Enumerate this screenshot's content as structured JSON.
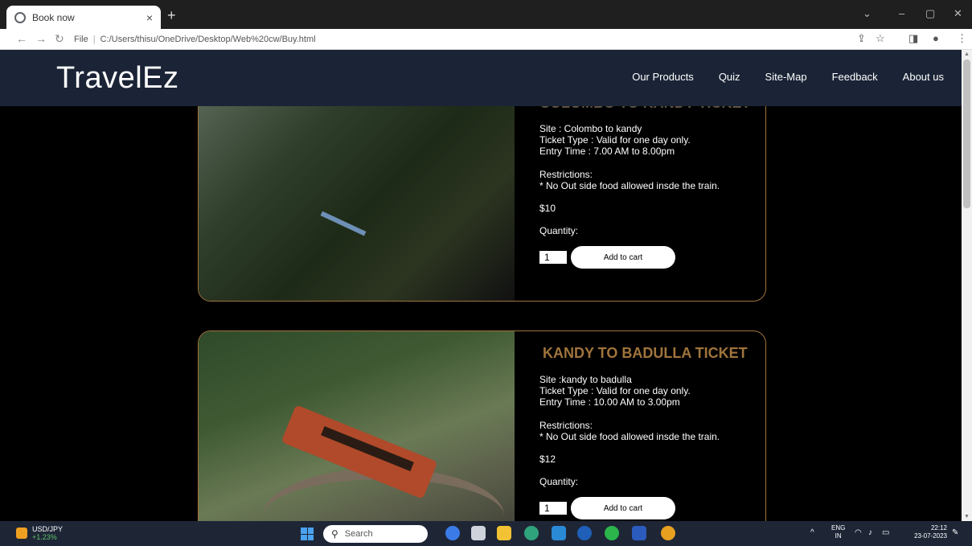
{
  "browser": {
    "tab_title": "Book now",
    "tab_close": "×",
    "new_tab": "+",
    "url_info_icon": "ⓘ",
    "url_scheme": "File",
    "url_path": "C:/Users/thisu/OneDrive/Desktop/Web%20cw/Buy.html"
  },
  "site": {
    "logo": "TravelEz",
    "nav": [
      "Our Products",
      "Quiz",
      "Site-Map",
      "Feedback",
      "About us"
    ]
  },
  "tickets": [
    {
      "title": "COLOMBO TO KANDY TICKET",
      "site": "Site : Colombo to kandy",
      "type": "Ticket Type : Valid for one day only.",
      "entry": "Entry Time : 7.00 AM to 8.00pm",
      "restrictions_label": "Restrictions:",
      "restriction": "* No Out side food allowed insde the train.",
      "price": "$10",
      "quantity_label": "Quantity:",
      "quantity": "1",
      "button": "Add to cart"
    },
    {
      "title": "KANDY TO BADULLA TICKET",
      "site": "Site :kandy to badulla",
      "type": "Ticket Type : Valid for one day only.",
      "entry": "Entry Time : 10.00 AM to 3.00pm",
      "restrictions_label": "Restrictions:",
      "restriction": "* No Out side food allowed insde the train.",
      "price": "$12",
      "quantity_label": "Quantity:",
      "quantity": "1",
      "button": "Add to cart"
    }
  ],
  "taskbar": {
    "widget_name": "USD/JPY",
    "widget_change": "+1.23%",
    "search": "Search",
    "lang_top": "ENG",
    "lang_bottom": "IN",
    "time": "22:12",
    "date": "23-07-2023"
  }
}
